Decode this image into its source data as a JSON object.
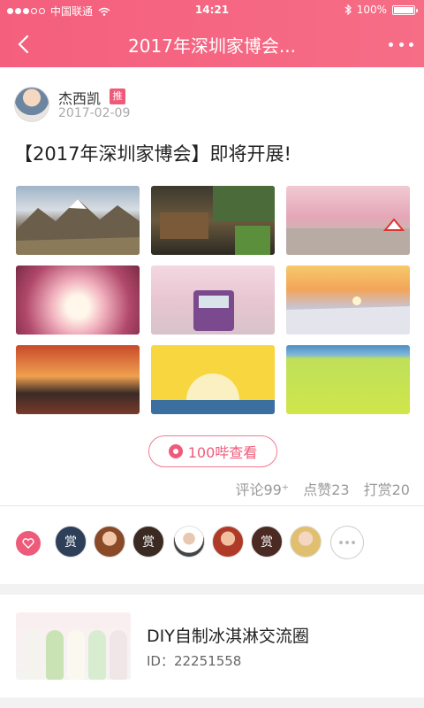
{
  "status": {
    "carrier": "中国联通",
    "time": "14:21",
    "battery": "100%"
  },
  "nav": {
    "title": "2017年深圳家博会..."
  },
  "author": {
    "name": "杰西凯",
    "badge": "推",
    "date": "2017-02-09"
  },
  "post": {
    "title": "【2017年深圳家博会】即将开展!",
    "images": [
      "mountains",
      "wooden-houses",
      "cherry-blossom-street",
      "pink-blossoms-sunlight",
      "purple-train-blossoms",
      "snowy-sunset",
      "lake-sunset",
      "yellow-sun-illustration",
      "green-grassland"
    ]
  },
  "view_button": {
    "label": "100哔查看"
  },
  "stats": {
    "comments": "评论99⁺",
    "likes": "点赞23",
    "rewards": "打赏20"
  },
  "donors": {
    "label": "赏"
  },
  "group": {
    "name": "DIY自制冰淇淋交流圈",
    "id": "ID：22251558"
  },
  "colors": {
    "accent": "#ee5a7a",
    "header_start": "#f45f7d",
    "header_end": "#f66d86"
  }
}
